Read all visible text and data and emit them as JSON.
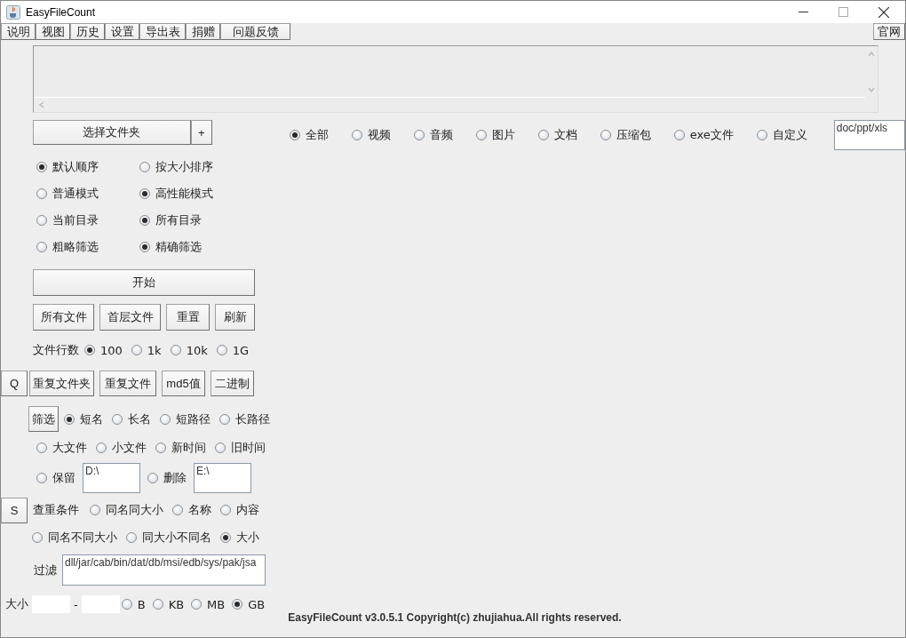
{
  "window": {
    "title": "EasyFileCount"
  },
  "menu": [
    {
      "label": "说明"
    },
    {
      "label": "视图"
    },
    {
      "label": "历史"
    },
    {
      "label": "设置"
    },
    {
      "label": "导出表"
    },
    {
      "label": "捐赠"
    },
    {
      "label": "问题反馈"
    }
  ],
  "menu_right": "官网",
  "folder_button": "选择文件夹",
  "add_button": "+",
  "type_filter": {
    "options": [
      {
        "label": "全部",
        "selected": true
      },
      {
        "label": "视频",
        "selected": false
      },
      {
        "label": "音频",
        "selected": false
      },
      {
        "label": "图片",
        "selected": false
      },
      {
        "label": "文档",
        "selected": false
      },
      {
        "label": "压缩包",
        "selected": false
      },
      {
        "label": "exe文件",
        "selected": false
      },
      {
        "label": "自定义",
        "selected": false
      }
    ],
    "custom_value": "doc/ppt/xls"
  },
  "option_rows": [
    {
      "options": [
        {
          "label": "默认顺序",
          "selected": true
        },
        {
          "label": "按大小排序",
          "selected": false
        }
      ]
    },
    {
      "options": [
        {
          "label": "普通模式",
          "selected": false
        },
        {
          "label": "高性能模式",
          "selected": true
        }
      ]
    },
    {
      "options": [
        {
          "label": "当前目录",
          "selected": false
        },
        {
          "label": "所有目录",
          "selected": true
        }
      ]
    },
    {
      "options": [
        {
          "label": "粗略筛选",
          "selected": false
        },
        {
          "label": "精确筛选",
          "selected": true
        }
      ]
    }
  ],
  "start_button": "开始",
  "scan_buttons": [
    "所有文件",
    "首层文件",
    "重置",
    "刷新"
  ],
  "line_count": {
    "label": "文件行数",
    "options": [
      {
        "label": "100",
        "selected": true
      },
      {
        "label": "1k",
        "selected": false
      },
      {
        "label": "10k",
        "selected": false
      },
      {
        "label": "1G",
        "selected": false
      }
    ]
  },
  "q_button": "Q",
  "duplicate_buttons": [
    "重复文件夹",
    "重复文件",
    "md5值",
    "二进制"
  ],
  "filter_button": "筛选",
  "sort": {
    "row1": [
      {
        "label": "短名",
        "selected": true
      },
      {
        "label": "长名",
        "selected": false
      },
      {
        "label": "短路径",
        "selected": false
      },
      {
        "label": "长路径",
        "selected": false
      }
    ],
    "row2": [
      {
        "label": "大文件",
        "selected": false
      },
      {
        "label": "小文件",
        "selected": false
      },
      {
        "label": "新时间",
        "selected": false
      },
      {
        "label": "旧时间",
        "selected": false
      }
    ]
  },
  "keep_delete": [
    {
      "label": "保留",
      "selected": false,
      "value": "D:\\"
    },
    {
      "label": "删除",
      "selected": false,
      "value": "E:\\"
    }
  ],
  "s_button": "S",
  "dup_criteria": {
    "label": "查重条件",
    "row1": [
      {
        "label": "同名同大小",
        "selected": false
      },
      {
        "label": "名称",
        "selected": false
      },
      {
        "label": "内容",
        "selected": false
      }
    ],
    "row2": [
      {
        "label": "同名不同大小",
        "selected": false
      },
      {
        "label": "同大小不同名",
        "selected": false
      },
      {
        "label": "大小",
        "selected": true
      }
    ]
  },
  "filter": {
    "label": "过滤",
    "value": "dll/jar/cab/bin/dat/db/msi/edb/sys/pak/jsa"
  },
  "size": {
    "label": "大小",
    "separator": "-",
    "units": [
      {
        "label": "B",
        "selected": false
      },
      {
        "label": "KB",
        "selected": false
      },
      {
        "label": "MB",
        "selected": false
      },
      {
        "label": "GB",
        "selected": true
      }
    ]
  },
  "footer": "EasyFileCount v3.0.5.1 Copyright(c) zhujiahua.All rights reserved."
}
